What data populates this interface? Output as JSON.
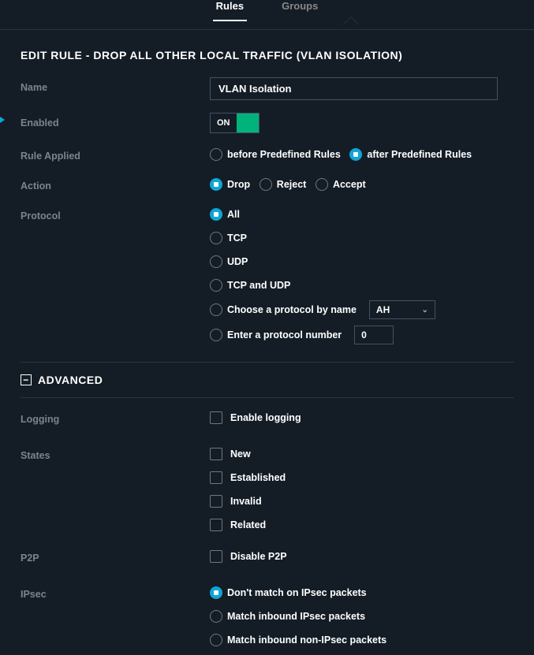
{
  "tabs": {
    "rules": "Rules",
    "groups": "Groups"
  },
  "title": "EDIT RULE - DROP ALL OTHER LOCAL TRAFFIC (VLAN ISOLATION)",
  "labels": {
    "name": "Name",
    "enabled": "Enabled",
    "ruleApplied": "Rule Applied",
    "action": "Action",
    "protocol": "Protocol",
    "logging": "Logging",
    "states": "States",
    "p2p": "P2P",
    "ipsec": "IPsec"
  },
  "name_value": "VLAN Isolation",
  "enabled_toggle": "ON",
  "ruleApplied": {
    "before": "before Predefined Rules",
    "after": "after Predefined Rules",
    "selected": "after"
  },
  "action": {
    "drop": "Drop",
    "reject": "Reject",
    "accept": "Accept",
    "selected": "drop"
  },
  "protocol": {
    "all": "All",
    "tcp": "TCP",
    "udp": "UDP",
    "tcpudp": "TCP and UDP",
    "byname": "Choose a protocol by name",
    "byname_value": "AH",
    "bynumber": "Enter a protocol number",
    "bynumber_value": "0",
    "selected": "all"
  },
  "advanced_title": "ADVANCED",
  "logging": {
    "enable": "Enable logging"
  },
  "states": {
    "new": "New",
    "established": "Established",
    "invalid": "Invalid",
    "related": "Related"
  },
  "p2p": {
    "disable": "Disable P2P"
  },
  "ipsec": {
    "none": "Don't match on IPsec packets",
    "inbound": "Match inbound IPsec packets",
    "noninbound": "Match inbound non-IPsec packets",
    "selected": "none"
  }
}
